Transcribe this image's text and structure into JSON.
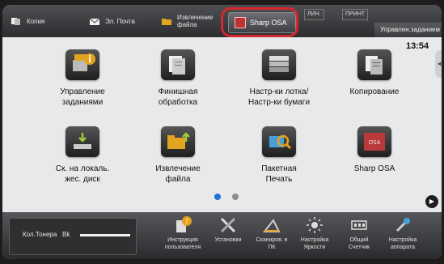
{
  "topbar": {
    "copy": "Копия",
    "email": "Эл. Почта",
    "retrieve": "Извлечение\nфайла",
    "osa": "Sharp OSA",
    "line": "ЛИН.",
    "print": "ПРИНТ",
    "job_status": "Управлен.заданием"
  },
  "clock": "13:54",
  "tiles": [
    {
      "label": "Управление\nзаданиями"
    },
    {
      "label": "Финишная\nобработка"
    },
    {
      "label": "Настр-ки лотка/\nНастр-ки бумаги"
    },
    {
      "label": "Копирование"
    },
    {
      "label": "Ск. на локаль.\nжес. диск"
    },
    {
      "label": "Извлечение\nфайла"
    },
    {
      "label": "Пакетная\nПечать"
    },
    {
      "label": "Sharp OSA"
    }
  ],
  "bottombar": {
    "toner_label": "Кол.Тонера",
    "toner_color": "Bk",
    "items": [
      {
        "label": "Инструкция\nпользователя"
      },
      {
        "label": "Установки"
      },
      {
        "label": "Сканиров. в\nПК"
      },
      {
        "label": "Настройка\nЯркости"
      },
      {
        "label": "Общий\nСчетчик"
      },
      {
        "label": "Настройка\nаппарата"
      }
    ]
  },
  "colors": {
    "highlight_ring": "#d6262e",
    "accent_orange": "#e8a21a",
    "page_dot_active": "#1f72d6"
  }
}
